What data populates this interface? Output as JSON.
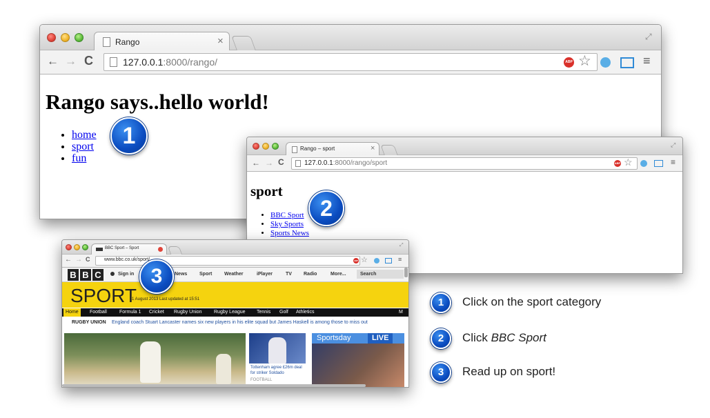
{
  "window1": {
    "tab_title": "Rango",
    "tab_close": "×",
    "url_host": "127.0.0.1",
    "url_rest": ":8000/rango/",
    "heading": "Rango says..hello world!",
    "links": [
      "home",
      "sport",
      "fun"
    ]
  },
  "window2": {
    "tab_title": "Rango – sport",
    "tab_close": "×",
    "url_host": "127.0.0.1",
    "url_rest": ":8000/rango/sport",
    "heading": "sport",
    "links": [
      "BBC Sport",
      "Sky Sports",
      "Sports News"
    ]
  },
  "window3": {
    "tab_title": "BBC Sport – Sport",
    "url": "www.bbc.co.uk/sport/",
    "bbc_logo": [
      "B",
      "B",
      "C"
    ],
    "sign_in": "Sign in",
    "nav": [
      "News",
      "Sport",
      "Weather",
      "iPlayer",
      "TV",
      "Radio",
      "More..."
    ],
    "search_placeholder": "Search",
    "sport_title": "SPORT",
    "updated": "1 August 2013 Last updated at 15:51",
    "subnav": [
      "Home",
      "Football",
      "Formula 1",
      "Cricket",
      "Rugby Union",
      "Rugby League",
      "Tennis",
      "Golf",
      "Athletics"
    ],
    "subnav_more": "M",
    "news_label": "RUGBY UNION",
    "news_text": "England coach Stuart Lancaster names six new players in his elite squad but James Haskell is among those to miss out",
    "story_caption": "Tottenham agree £26m deal for striker Soldado",
    "story_tag": "FOOTBALL",
    "live_label": "Sportsday",
    "live_badge": "LIVE"
  },
  "badges": [
    "1",
    "2",
    "3"
  ],
  "steps": [
    {
      "num": "1",
      "text": "Click on the sport category"
    },
    {
      "num": "2",
      "text": "Click BBC Sport"
    },
    {
      "num": "3",
      "text": "Read up on sport!"
    }
  ],
  "colors": {
    "badge_blue": "#0b4cc0",
    "link": "#0000ee",
    "bbc_yellow": "#f5d30f",
    "abp_red": "#d9302a"
  }
}
